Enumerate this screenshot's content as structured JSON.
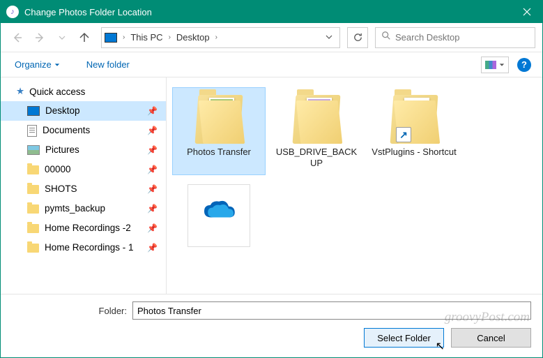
{
  "window": {
    "title": "Change Photos Folder Location"
  },
  "breadcrumb": {
    "parts": [
      "This PC",
      "Desktop"
    ]
  },
  "search": {
    "placeholder": "Search Desktop"
  },
  "toolbar": {
    "organize": "Organize",
    "newfolder": "New folder"
  },
  "sidebar": {
    "quickaccess": "Quick access",
    "items": [
      {
        "label": "Desktop",
        "icon": "desktop",
        "pinned": true,
        "selected": true
      },
      {
        "label": "Documents",
        "icon": "doc",
        "pinned": true
      },
      {
        "label": "Pictures",
        "icon": "pics",
        "pinned": true
      },
      {
        "label": "00000",
        "icon": "folder",
        "pinned": true
      },
      {
        "label": "SHOTS",
        "icon": "folder",
        "pinned": true
      },
      {
        "label": "pymts_backup",
        "icon": "folder",
        "pinned": true
      },
      {
        "label": "Home Recordings -2",
        "icon": "folder",
        "pinned": true
      },
      {
        "label": "Home Recordings - 1",
        "icon": "folder",
        "pinned": true
      }
    ]
  },
  "content": {
    "items": [
      {
        "label": "Photos Transfer",
        "kind": "folder-photo1",
        "selected": true
      },
      {
        "label": "USB_DRIVE_BACKUP",
        "kind": "folder-photo2"
      },
      {
        "label": "VstPlugins - Shortcut",
        "kind": "folder-shortcut"
      },
      {
        "label": "",
        "kind": "onedrive"
      }
    ]
  },
  "bottom": {
    "folder_label": "Folder:",
    "folder_value": "Photos Transfer",
    "select": "Select Folder",
    "cancel": "Cancel"
  },
  "watermark": "groovyPost.com"
}
